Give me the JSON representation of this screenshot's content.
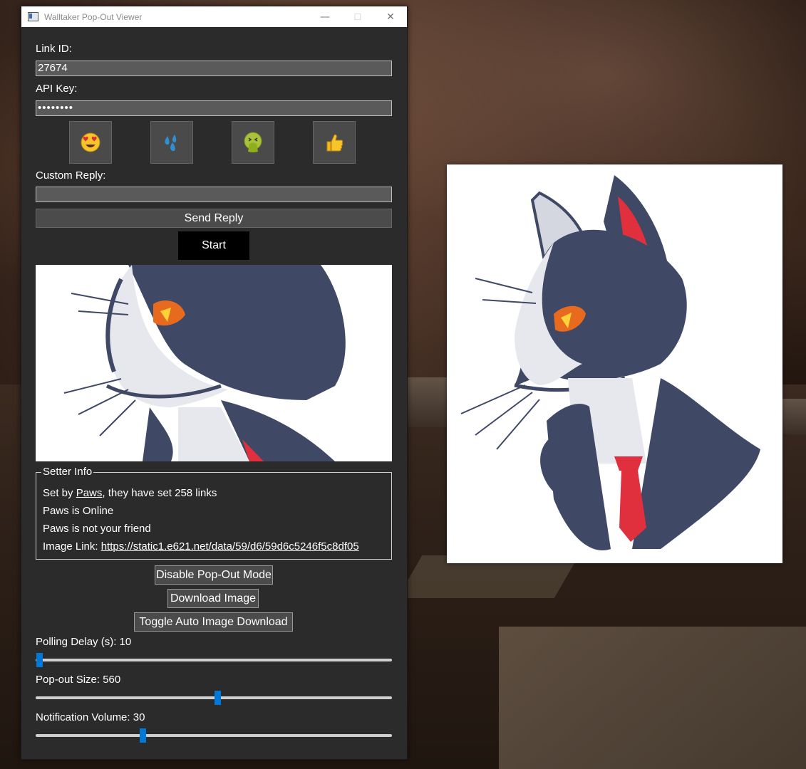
{
  "window": {
    "title": "Walltaker Pop-Out Viewer",
    "minimize": "—",
    "maximize": "☐",
    "close": "✕"
  },
  "form": {
    "link_id_label": "Link ID:",
    "link_id_value": "27674",
    "api_key_label": "API Key:",
    "api_key_value": "••••••••",
    "custom_reply_label": "Custom Reply:",
    "custom_reply_value": "",
    "send_reply_label": "Send Reply",
    "start_label": "Start"
  },
  "reactions": [
    {
      "name": "heart-eyes-emoji-icon",
      "glyph": "😍"
    },
    {
      "name": "sweat-droplets-emoji-icon",
      "glyph": "💦"
    },
    {
      "name": "vomiting-face-emoji-icon",
      "glyph": "🤮"
    },
    {
      "name": "thumbs-up-emoji-icon",
      "glyph": "👍"
    }
  ],
  "setter_info": {
    "legend": "Setter Info",
    "set_by_prefix": "Set by ",
    "setter_name": "Paws",
    "set_by_suffix": ", they have set 258 links",
    "online_status": "Paws is Online",
    "friend_status": "Paws is not your friend",
    "image_link_label": "Image Link: ",
    "image_link_url": "https://static1.e621.net/data/59/d6/59d6c5246f5c8df05"
  },
  "actions": {
    "disable_popout": "Disable Pop-Out Mode",
    "download_image": "Download Image",
    "toggle_auto_download": "Toggle Auto Image Download"
  },
  "sliders": {
    "polling_delay_label": "Polling Delay (s): 10",
    "polling_delay_fraction": 0.01,
    "popout_size_label": "Pop-out Size: 560",
    "popout_size_fraction": 0.51,
    "notification_volume_label": "Notification Volume: 30",
    "notification_volume_fraction": 0.3
  },
  "colors": {
    "window_bg": "#2b2b2b",
    "field_bg": "#5a5a5a",
    "button_bg": "#4b4b4b",
    "slider_accent": "#0078d7",
    "artwork_navy": "#3f4865",
    "artwork_red": "#e0303e"
  }
}
